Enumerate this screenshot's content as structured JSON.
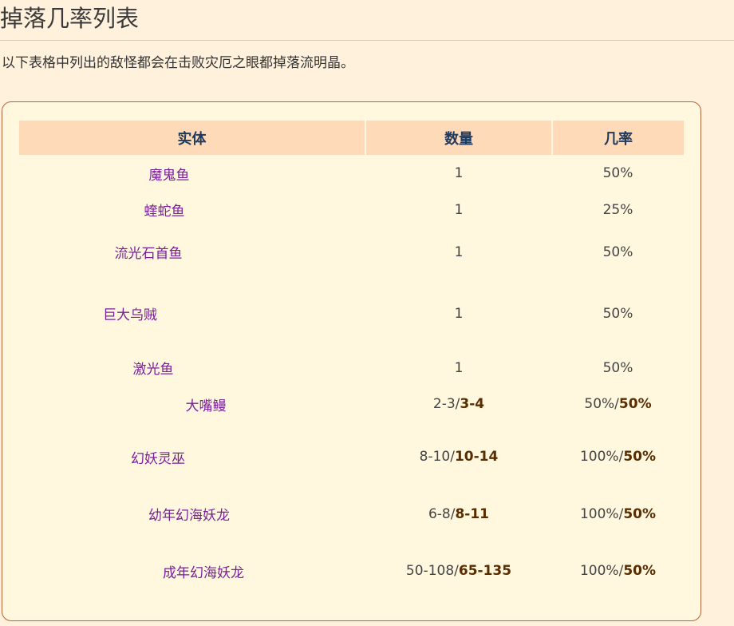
{
  "page": {
    "title": "掉落几率列表",
    "intro": "以下表格中列出的敌怪都会在击败灾厄之眼都掉落流明晶。"
  },
  "table": {
    "headers": [
      "实体",
      "数量",
      "几率"
    ],
    "rows": [
      {
        "entity": "魔鬼鱼",
        "qty": "1",
        "qty_strong": "",
        "rate": "50%",
        "rate_strong": ""
      },
      {
        "entity": "蝰蛇鱼",
        "qty": "1",
        "qty_strong": "",
        "rate": "25%",
        "rate_strong": ""
      },
      {
        "entity": "流光石首鱼",
        "qty": "1",
        "qty_strong": "",
        "rate": "50%",
        "rate_strong": ""
      },
      {
        "entity": "巨大乌贼",
        "qty": "1",
        "qty_strong": "",
        "rate": "50%",
        "rate_strong": ""
      },
      {
        "entity": "激光鱼",
        "qty": "1",
        "qty_strong": "",
        "rate": "50%",
        "rate_strong": ""
      },
      {
        "entity": "大嘴鳗",
        "qty": "2-3/",
        "qty_strong": "3-4",
        "rate": "50%/",
        "rate_strong": "50%"
      },
      {
        "entity": "幻妖灵巫",
        "qty": "8-10/",
        "qty_strong": "10-14",
        "rate": "100%/",
        "rate_strong": "50%"
      },
      {
        "entity": "幼年幻海妖龙",
        "qty": "6-8/",
        "qty_strong": "8-11",
        "rate": "100%/",
        "rate_strong": "50%"
      },
      {
        "entity": "成年幻海妖龙",
        "qty": "50-108/",
        "qty_strong": "65-135",
        "rate": "100%/",
        "rate_strong": "50%"
      }
    ]
  }
}
